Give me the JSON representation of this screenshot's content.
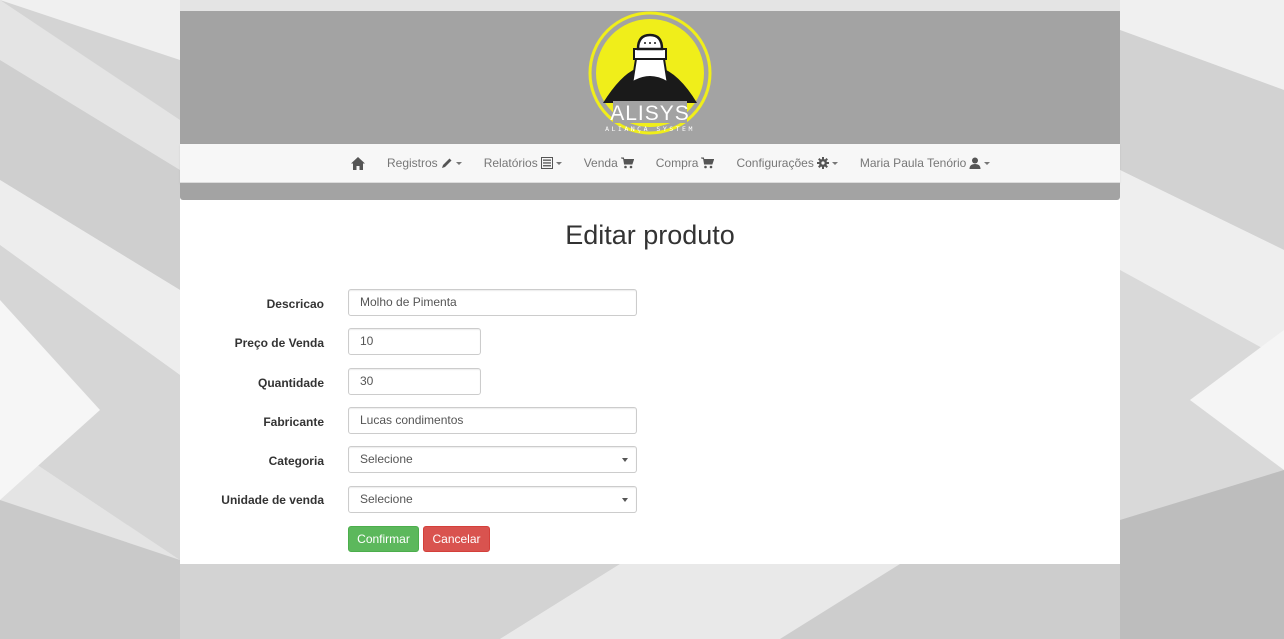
{
  "brand": {
    "name": "ALISYS",
    "tagline": "ALIANÇA SYSTEM"
  },
  "nav": {
    "home_icon": "home-icon",
    "items": [
      {
        "label": "Registros",
        "icon": "pencil-icon",
        "dropdown": true
      },
      {
        "label": "Relatórios",
        "icon": "list-alt-icon",
        "dropdown": true
      },
      {
        "label": "Venda",
        "icon": "shopping-cart-icon",
        "dropdown": false
      },
      {
        "label": "Compra",
        "icon": "shopping-cart-icon",
        "dropdown": false
      },
      {
        "label": "Configurações",
        "icon": "cog-icon",
        "dropdown": true
      },
      {
        "label": "Maria Paula Tenório",
        "icon": "user-icon",
        "dropdown": true
      }
    ]
  },
  "page": {
    "title": "Editar produto"
  },
  "form": {
    "descricao": {
      "label": "Descricao",
      "value": "Molho de Pimenta"
    },
    "preco": {
      "label": "Preço de Venda",
      "value": "10"
    },
    "quantidade": {
      "label": "Quantidade",
      "value": "30"
    },
    "fabricante": {
      "label": "Fabricante",
      "value": "Lucas condimentos"
    },
    "categoria": {
      "label": "Categoria",
      "value": "Selecione"
    },
    "unidade": {
      "label": "Unidade de venda",
      "value": "Selecione"
    }
  },
  "buttons": {
    "confirm": "Confirmar",
    "cancel": "Cancelar"
  },
  "colors": {
    "header_bg": "#a3a3a3",
    "logo_yellow": "#f0ee1a",
    "success": "#5cb85c",
    "danger": "#d9534f"
  }
}
